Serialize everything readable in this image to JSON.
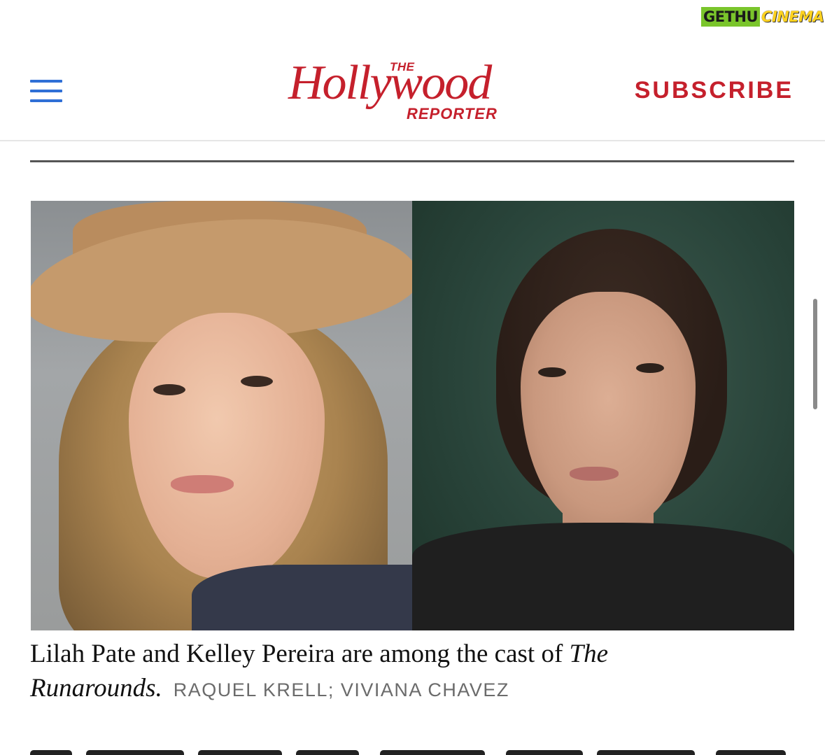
{
  "watermark": {
    "part1": "GETHU",
    "part2": "CINEMA"
  },
  "header": {
    "logo": {
      "the": "THE",
      "main": "Hollywood",
      "reporter": "REPORTER"
    },
    "subscribe_label": "SUBSCRIBE",
    "menu_icon": "hamburger-menu-icon"
  },
  "photo": {
    "left_subject": "Lilah Pate",
    "right_subject": "Kelley Pereira"
  },
  "caption": {
    "text": "Lilah Pate and Kelley Pereira are among the cast of ",
    "show_title": "The Runarounds.",
    "credit": "RAQUEL KRELL; VIVIANA CHAVEZ"
  },
  "colors": {
    "brand_red": "#c5202c",
    "menu_blue": "#2f6fd6"
  }
}
